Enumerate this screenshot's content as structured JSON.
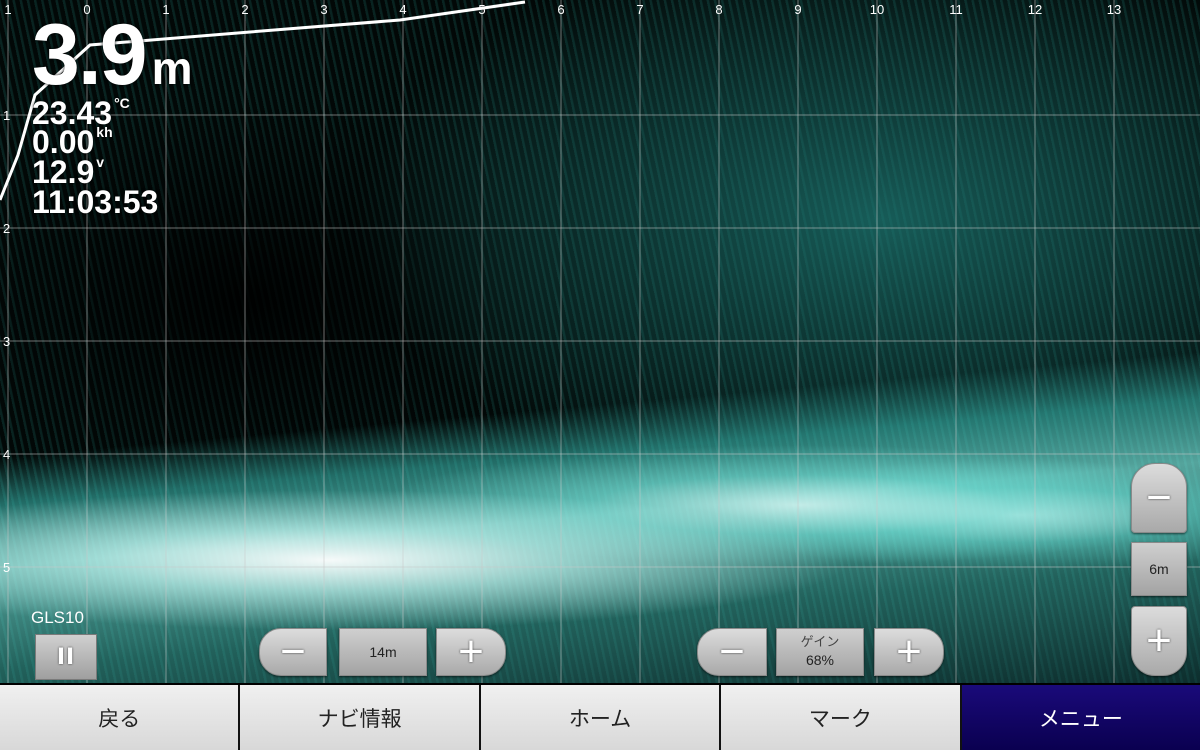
{
  "readouts": {
    "depth_value": "3.9",
    "depth_unit": "m",
    "water_temp": "23.43",
    "water_temp_unit": "°C",
    "speed": "0.00",
    "speed_unit": "kh",
    "voltage": "12.9",
    "voltage_unit": "v",
    "time": "11:03:53"
  },
  "axes": {
    "x_ticks": [
      "1",
      "0",
      "1",
      "2",
      "3",
      "4",
      "5",
      "6",
      "7",
      "8",
      "9",
      "10",
      "11",
      "12",
      "13"
    ],
    "y_ticks": [
      "1",
      "2",
      "3",
      "4",
      "5"
    ]
  },
  "sonar": {
    "source": "GLS10",
    "range": "14m",
    "gain_label": "ゲイン",
    "gain_value": "68%",
    "zoom_value": "6m"
  },
  "colors": {
    "sonar_echo": "#3ccfc0",
    "strong_echo": "#ffffff",
    "menu_active": "#0a0050"
  },
  "icons": {
    "pause": "pause-icon",
    "minus": "minus-icon",
    "plus": "plus-icon"
  },
  "nav": [
    {
      "label": "戻る"
    },
    {
      "label": "ナビ情報"
    },
    {
      "label": "ホーム"
    },
    {
      "label": "マーク"
    },
    {
      "label": "メニュー",
      "active": true
    }
  ]
}
